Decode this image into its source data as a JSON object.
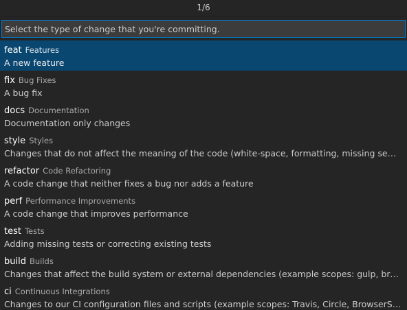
{
  "quick_pick": {
    "counter": "1/6",
    "input": {
      "placeholder": "Select the type of change that you're committing.",
      "value": ""
    },
    "items": [
      {
        "label": "feat",
        "description": "Features",
        "detail": "A new feature",
        "selected": true
      },
      {
        "label": "fix",
        "description": "Bug Fixes",
        "detail": "A bug fix",
        "selected": false
      },
      {
        "label": "docs",
        "description": "Documentation",
        "detail": "Documentation only changes",
        "selected": false
      },
      {
        "label": "style",
        "description": "Styles",
        "detail": "Changes that do not affect the meaning of the code (white-space, formatting, missing semi-colons,...",
        "selected": false
      },
      {
        "label": "refactor",
        "description": "Code Refactoring",
        "detail": "A code change that neither fixes a bug nor adds a feature",
        "selected": false
      },
      {
        "label": "perf",
        "description": "Performance Improvements",
        "detail": "A code change that improves performance",
        "selected": false
      },
      {
        "label": "test",
        "description": "Tests",
        "detail": "Adding missing tests or correcting existing tests",
        "selected": false
      },
      {
        "label": "build",
        "description": "Builds",
        "detail": "Changes that affect the build system or external dependencies (example scopes: gulp, broccoli, npm)",
        "selected": false
      },
      {
        "label": "ci",
        "description": "Continuous Integrations",
        "detail": "Changes to our CI configuration files and scripts (example scopes: Travis, Circle, BrowserStack, Sauc...",
        "selected": false
      }
    ]
  },
  "colors": {
    "background": "#252526",
    "selected_row": "#094771",
    "input_border": "#007fd4"
  }
}
